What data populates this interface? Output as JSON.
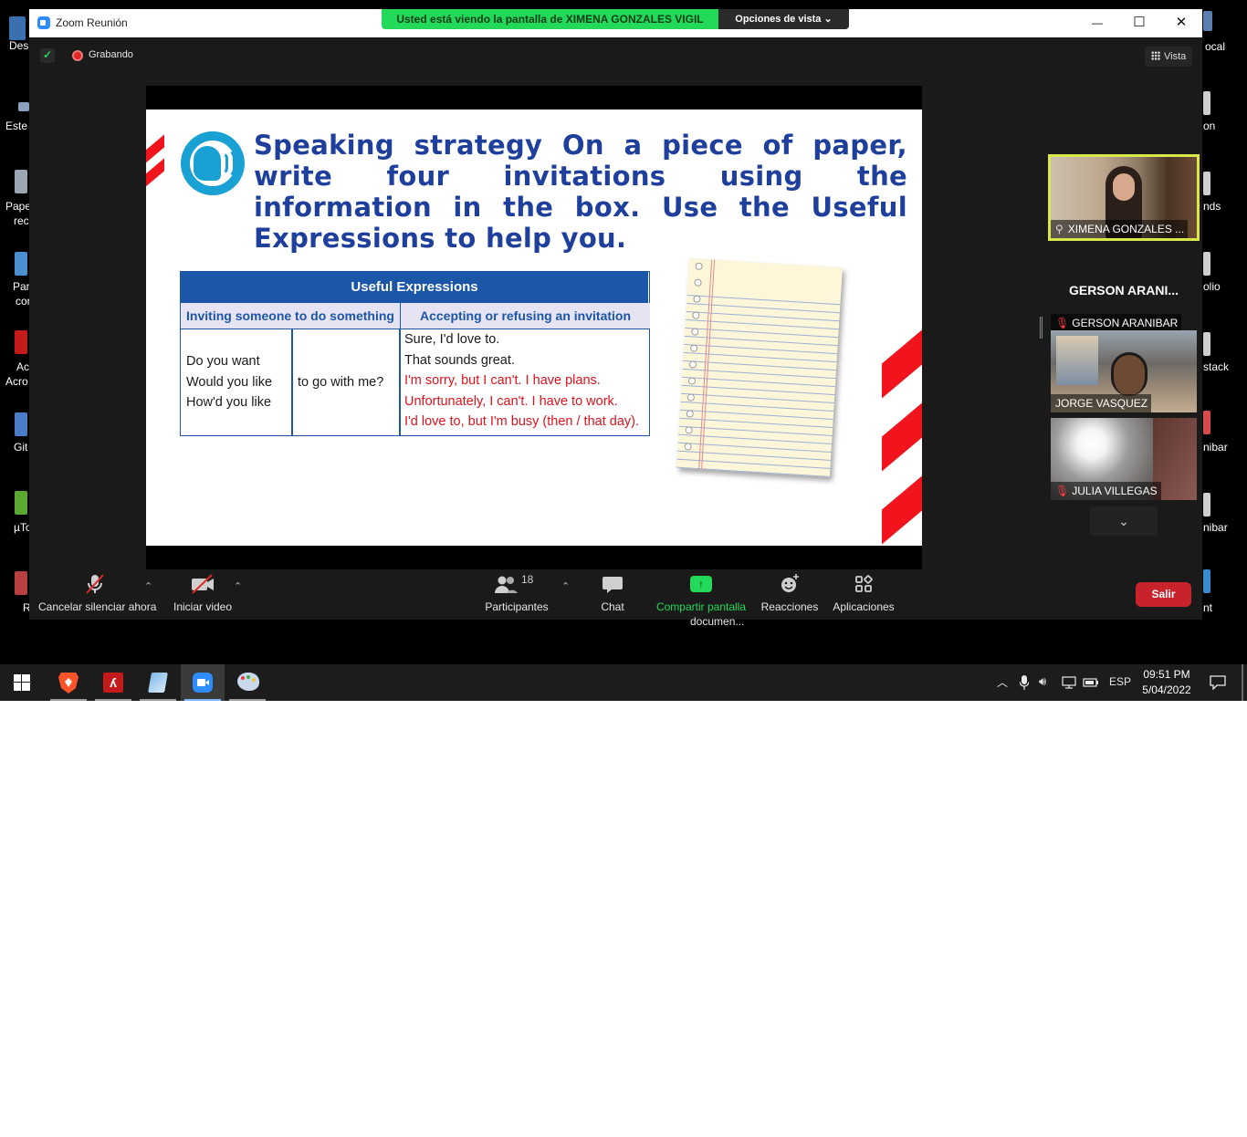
{
  "window": {
    "title": "Zoom Reunión",
    "share_banner": "Usted está viendo la pantalla de  XIMENA GONZALES VIGIL",
    "view_options": "Opciones de vista",
    "view_options_caret": "⌄",
    "minimize": "—",
    "maximize": "☐",
    "close": "✕"
  },
  "topbar": {
    "recording": "Grabando",
    "view_button": "Vista"
  },
  "slide": {
    "title": "Speaking strategy On a piece of paper, write four invitations using the information in the box. Use the Useful Expressions to help you.",
    "table": {
      "header": "Useful Expressions",
      "col1_header": "Inviting someone to do something",
      "col2_header": "Accepting or refusing an invitation",
      "col1_lines": [
        "Do you want",
        "Would you like",
        "How'd you like"
      ],
      "middle": "to go with me?",
      "accept_lines": [
        "Sure, I'd love to.",
        "That sounds great."
      ],
      "refuse_lines": [
        "I'm sorry, but I can't. I have plans.",
        "Unfortunately, I can't. I have to work.",
        "I'd love to, but I'm busy (then / that day)."
      ]
    }
  },
  "participants_panel": {
    "tiles": [
      {
        "name": "XIMENA GONZALES ...",
        "pinned": true
      },
      {
        "big_name": "GERSON  ARANI...",
        "name": "GERSON ARANIBAR",
        "muted": true
      },
      {
        "name": "JORGE VASQUEZ",
        "muted": false
      },
      {
        "name": "JULIA VILLEGAS",
        "muted": true
      }
    ],
    "scroll_down": "⌄"
  },
  "toolbar": {
    "unmute": "Cancelar silenciar ahora",
    "start_video": "Iniciar video",
    "participants": "Participantes",
    "participants_count": "18",
    "chat": "Chat",
    "share": "Compartir pantalla",
    "share_sub": "documen...",
    "reactions": "Reacciones",
    "apps": "Aplicaciones",
    "leave": "Salir",
    "caret": "⌃"
  },
  "desktop_icons": {
    "left": [
      "Desc",
      "Este e",
      "Pape",
      "rec",
      "Par",
      "cor",
      "Ac",
      "Acro",
      "Git",
      "µTo",
      "R"
    ],
    "right": [
      "ocal",
      "on",
      "nds",
      "olio",
      "stack",
      "nibar",
      "nibar",
      "nt"
    ]
  },
  "taskbar": {
    "lang": "ESP",
    "time": "09:51 PM",
    "date": "5/04/2022"
  },
  "colors": {
    "zoom_green": "#23d959",
    "leave_red": "#c8222a",
    "slide_blue": "#1e3f9c",
    "refuse_red": "#e0121b",
    "active_speaker": "#d8e84a"
  }
}
